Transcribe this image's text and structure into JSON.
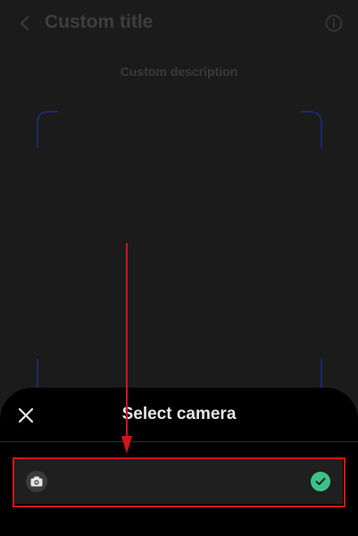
{
  "header": {
    "title": "Custom title",
    "back_icon": "chevron-left-icon",
    "info_icon": "info-icon"
  },
  "scanner": {
    "description": "Custom description",
    "frame_color": "#1a2a6b"
  },
  "sheet": {
    "title": "Select camera",
    "close_icon": "close-icon",
    "options": [
      {
        "label": "",
        "icon": "camera-icon",
        "selected": true
      }
    ]
  },
  "colors": {
    "background": "#1b1b1b",
    "sheet_background": "#000000",
    "option_background": "#1f1f1f",
    "selected_check": "#3ec28a",
    "annotation": "#d0141c"
  }
}
